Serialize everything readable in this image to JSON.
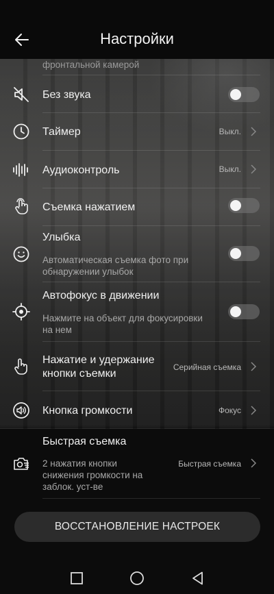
{
  "header": {
    "title": "Настройки"
  },
  "settings": {
    "partial_text": "фронтальной камерой",
    "mute": {
      "label": "Без звука",
      "enabled": false
    },
    "timer": {
      "label": "Таймер",
      "value": "Выкл."
    },
    "audio": {
      "label": "Аудиоконтроль",
      "value": "Выкл."
    },
    "touch": {
      "label": "Съемка нажатием",
      "enabled": false
    },
    "smile": {
      "label": "Улыбка",
      "sub1": "Автоматическая съемка фото при",
      "sub2": "обнаружении улыбок",
      "enabled": false
    },
    "af": {
      "label": "Автофокус в движении",
      "sub1": "Нажмите на объект для фокусировки",
      "sub2": "на нем",
      "enabled": false
    },
    "hold": {
      "label1": "Нажатие и удержание",
      "label2": "кнопки съемки",
      "value": "Серийная съемка"
    },
    "volume": {
      "label": "Кнопка громкости",
      "value": "Фокус"
    },
    "quick": {
      "label": "Быстрая съемка",
      "sub1": "2 нажатия кнопки",
      "sub2": "снижения громкости на",
      "sub3": "заблок. уст-ве",
      "value": "Быстрая съемка"
    }
  },
  "reset_button": {
    "label": "ВОССТАНОВЛЕНИЕ НАСТРОЕК"
  },
  "colors": {
    "background": "#0a0a0a",
    "toggle_off": "#787878",
    "text": "#f0f0f0",
    "secondary": "#a8a8a8"
  },
  "icons": [
    "back-arrow-icon",
    "mute-icon",
    "timer-icon",
    "audio-icon",
    "touch-icon",
    "smile-icon",
    "focus-icon",
    "hand-icon",
    "volume-icon",
    "quick-camera-icon",
    "chevron-right-icon",
    "square-icon",
    "circle-icon",
    "triangle-back-icon"
  ]
}
